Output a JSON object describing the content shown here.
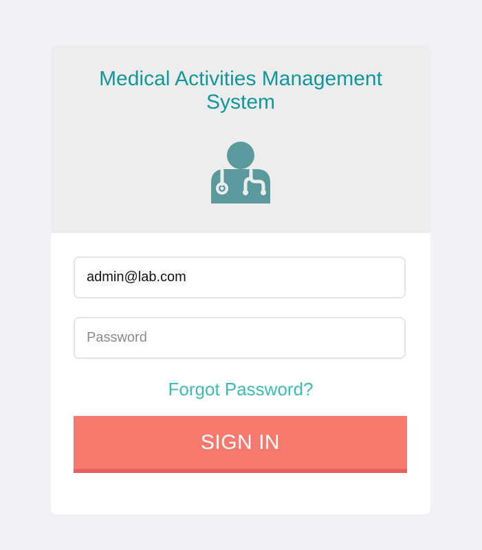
{
  "header": {
    "title": "Medical Activities Management System",
    "icon": "doctor-stethoscope-icon"
  },
  "form": {
    "email_value": "admin@lab.com",
    "password_placeholder": "Password",
    "password_value": "",
    "forgot_label": "Forgot Password?",
    "signin_label": "SIGN IN"
  },
  "colors": {
    "background": "#f1f2f6",
    "header_bg": "#ededed",
    "title": "#11979b",
    "icon": "#5a9a9c",
    "link": "#3dbbb5",
    "button": "#f6796d",
    "button_shadow": "#e6625a"
  }
}
